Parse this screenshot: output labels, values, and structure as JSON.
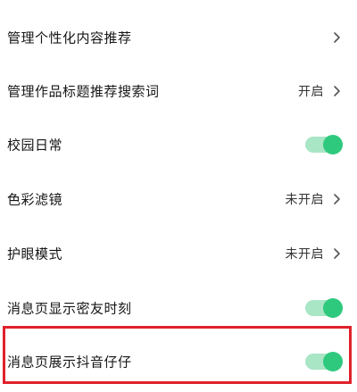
{
  "settings": {
    "items": [
      {
        "label": "管理个性化内容推荐",
        "status": "",
        "control": "chevron",
        "icon": "chevron-right-icon"
      },
      {
        "label": "管理作品标题推荐搜索词",
        "status": "开启",
        "control": "chevron",
        "icon": "chevron-right-icon"
      },
      {
        "label": "校园日常",
        "status": "",
        "control": "toggle",
        "toggle_on": true
      },
      {
        "label": "色彩滤镜",
        "status": "未开启",
        "control": "chevron",
        "icon": "chevron-right-icon"
      },
      {
        "label": "护眼模式",
        "status": "未开启",
        "control": "chevron",
        "icon": "chevron-right-icon"
      },
      {
        "label": "消息页显示密友时刻",
        "status": "",
        "control": "toggle",
        "toggle_on": true
      },
      {
        "label": "消息页展示抖音仔仔",
        "status": "",
        "control": "toggle",
        "toggle_on": true
      }
    ]
  },
  "highlight": {
    "color": "#e0212b",
    "target": "消息页展示抖音仔仔"
  },
  "colors": {
    "toggle_track": "#a9e6c6",
    "toggle_knob": "#2fc97e"
  }
}
